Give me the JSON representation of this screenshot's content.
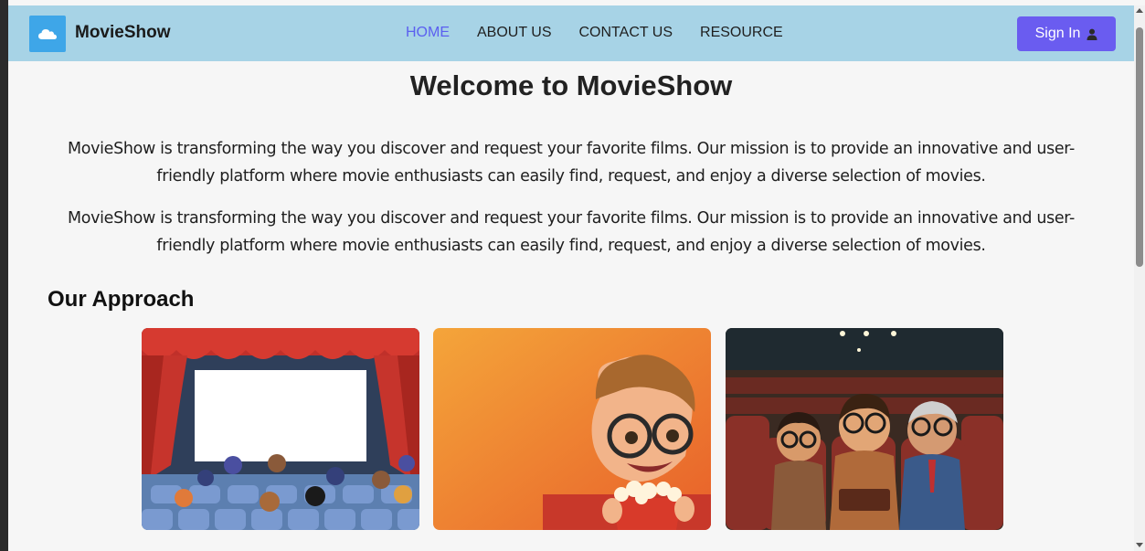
{
  "navbar": {
    "brand": "MovieShow",
    "links": [
      {
        "label": "HOME",
        "active": true
      },
      {
        "label": "ABOUT US",
        "active": false
      },
      {
        "label": "CONTACT US",
        "active": false
      },
      {
        "label": "RESOURCE",
        "active": false
      }
    ],
    "signin_label": "Sign In",
    "logo_icon": "cloud-icon",
    "signin_icon": "user-icon"
  },
  "main": {
    "title": "Welcome to MovieShow",
    "paragraphs": [
      "MovieShow is transforming the way you discover and request your favorite films. Our mission is to provide an innovative and user-friendly platform where movie enthusiasts can easily find, request, and enjoy a diverse selection of movies.",
      "MovieShow is transforming the way you discover and request your favorite films. Our mission is to provide an innovative and user-friendly platform where movie enthusiasts can easily find, request, and enjoy a diverse selection of movies."
    ],
    "section_title": "Our Approach"
  },
  "colors": {
    "navbar_bg": "#a7d3e6",
    "accent": "#6a5cf0",
    "active_link": "#5b5ff0",
    "logo_bg": "#3ea6e8"
  }
}
